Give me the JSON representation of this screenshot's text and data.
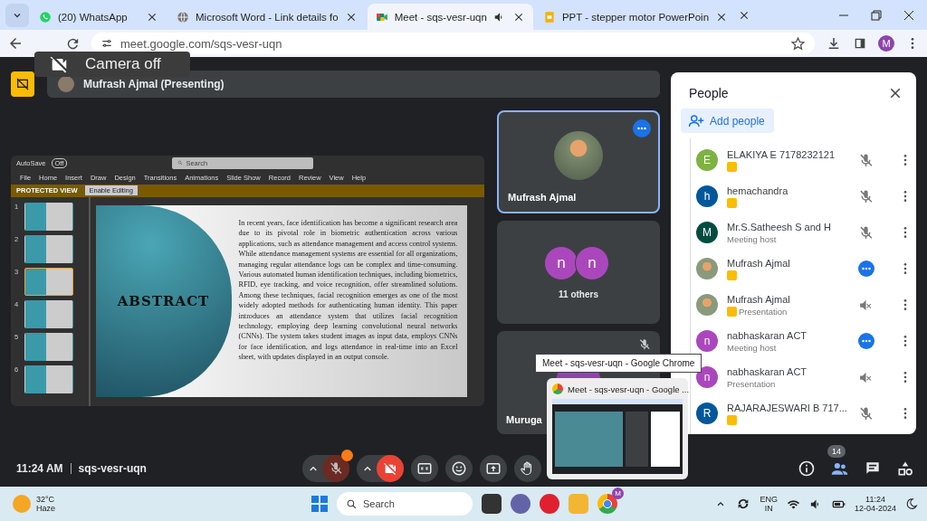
{
  "browser": {
    "tabs": [
      {
        "title": "(20) WhatsApp",
        "selected": false,
        "audio": false
      },
      {
        "title": "Microsoft Word - Link details fo",
        "selected": false,
        "audio": false
      },
      {
        "title": "Meet - sqs-vesr-uqn",
        "selected": true,
        "audio": true
      },
      {
        "title": "PPT - stepper motor PowerPoin",
        "selected": false,
        "audio": false
      }
    ],
    "url": "meet.google.com/sqs-vesr-uqn",
    "profile_initial": "M"
  },
  "toast": {
    "text": "Camera off"
  },
  "meet": {
    "presenting_label": "Mufrash Ajmal (Presenting)",
    "presentation": {
      "autosave_label": "AutoSave",
      "autosave_state": "Off",
      "search_placeholder": "Search",
      "menu": [
        "File",
        "Home",
        "Insert",
        "Draw",
        "Design",
        "Transitions",
        "Animations",
        "Slide Show",
        "Record",
        "Review",
        "View",
        "Help"
      ],
      "protected_label": "PROTECTED VIEW",
      "enable_button": "Enable Editing",
      "slides": [
        {
          "number": "1",
          "selected": false
        },
        {
          "number": "2",
          "selected": false
        },
        {
          "number": "3",
          "selected": true
        },
        {
          "number": "4",
          "selected": false
        },
        {
          "number": "5",
          "selected": false
        },
        {
          "number": "6",
          "selected": false
        }
      ],
      "slide_title": "ABSTRACT",
      "slide_body": "In recent years, face identification has become a significant research area due to its pivotal role in biometric authentication across various applications, such as attendance management and access control systems. While attendance management systems are essential for all organizations, managing regular attendance logs can be complex and time-consuming. Various automated human identification techniques, including biometrics, RFID, eye tracking, and voice recognition, offer streamlined solutions. Among these techniques, facial recognition emerges as one of the most widely adopted methods for authenticating human identity. This paper introduces an attendance system that utilizes facial recognition technology, employing deep learning convolutional neural networks (CNNs). The system takes student images as input data, employs CNNs for face identification, and logs attendance in real-time into an Excel sheet, with updates displayed in an output console."
    },
    "tiles": [
      {
        "kind": "photo",
        "name": "Mufrash Ajmal",
        "selected": true
      },
      {
        "kind": "group",
        "initials": [
          "n",
          "n"
        ],
        "label": "11 others",
        "selected": false
      },
      {
        "kind": "initial",
        "name": "Muruga",
        "color": "#8e44ad",
        "selected": false
      }
    ],
    "time": "11:24 AM",
    "code": "sqs-vesr-uqn",
    "mic_on": false,
    "camera_on": false,
    "people_count": "14"
  },
  "people": {
    "title": "People",
    "add_button": "Add people",
    "participants": [
      {
        "kind": "person",
        "initial": "E",
        "color": "#7cb342",
        "name": "ELAKIYA E 7178232121",
        "badge": true,
        "speaking": false
      },
      {
        "kind": "person",
        "initial": "h",
        "color": "#01579b",
        "name": "hemachandra",
        "badge": true,
        "speaking": false
      },
      {
        "kind": "person",
        "initial": "M",
        "color": "#004d40",
        "name": "Mr.S.Satheesh S and H",
        "role": "Meeting host",
        "badge": false,
        "speaking": false
      },
      {
        "kind": "person",
        "photo": true,
        "name": "Mufrash Ajmal",
        "badge": true,
        "speaking": true
      },
      {
        "kind": "presentation",
        "photo": true,
        "name": "Mufrash Ajmal",
        "role": "Presentation",
        "badge": true,
        "speaking": false
      },
      {
        "kind": "person",
        "initial": "n",
        "color": "#ab47bc",
        "name": "nabhaskaran ACT",
        "role": "Meeting host",
        "badge": false,
        "speaking": true
      },
      {
        "kind": "presentation",
        "initial": "n",
        "color": "#ab47bc",
        "name": "nabhaskaran ACT",
        "role": "Presentation",
        "badge": false,
        "speaking": false
      },
      {
        "kind": "person",
        "initial": "R",
        "color": "#01579b",
        "name": "RAJARAJESWARI B 717...",
        "badge": true,
        "speaking": false
      }
    ]
  },
  "tooltip": {
    "text": "Meet - sqs-vesr-uqn - Google Chrome"
  },
  "preview": {
    "title": "Meet - sqs-vesr-uqn - Google ..."
  },
  "taskbar": {
    "temperature": "32°C",
    "weather": "Haze",
    "search_placeholder": "Search",
    "language": "ENG",
    "region": "IN",
    "time": "11:24",
    "date": "12-04-2024",
    "chrome_badge": "M"
  }
}
